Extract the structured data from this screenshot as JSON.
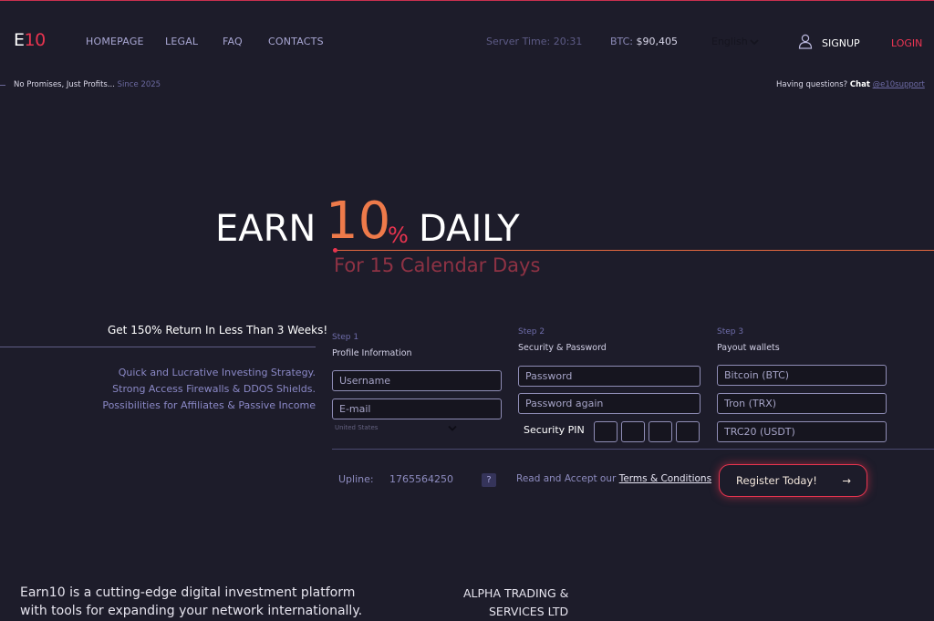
{
  "header": {
    "logo_e": "E",
    "logo_num": "10",
    "nav": [
      {
        "label": "HOMEPAGE"
      },
      {
        "label": "LEGAL"
      },
      {
        "label": "FAQ"
      },
      {
        "label": "CONTACTS"
      }
    ],
    "server_time_label": "Server Time:",
    "server_time": "20:31",
    "btc_label": "BTC:",
    "btc_price": "$90,405",
    "language": "English",
    "signup_label": "SIGNUP",
    "login_label": "LOGIN"
  },
  "subheader": {
    "tagline": "No Promises, Just Profits...",
    "since": "Since 2025",
    "questions": "Having questions?",
    "chat": "Chat",
    "support_handle": "@e10support"
  },
  "hero": {
    "earn": "EARN",
    "number": "10",
    "percent": "%",
    "daily": "DAILY",
    "subline": "For 15 Calendar Days"
  },
  "info": {
    "headline": "Get 150% Return In Less Than 3 Weeks!",
    "features": [
      "Quick and Lucrative Investing Strategy.",
      "Strong Access Firewalls & DDOS Shields.",
      "Possibilities for Affiliates & Passive Income"
    ]
  },
  "form": {
    "step1": {
      "step": "Step 1",
      "title": "Profile Information"
    },
    "step2": {
      "step": "Step 2",
      "title": "Security & Password"
    },
    "step3": {
      "step": "Step 3",
      "title": "Payout wallets"
    },
    "username_placeholder": "Username",
    "email_placeholder": "E-mail",
    "country": "United States",
    "password_placeholder": "Password",
    "password_again_placeholder": "Password again",
    "pin_label": "Security PIN",
    "btc_wallet_placeholder": "Bitcoin (BTC)",
    "trx_wallet_placeholder": "Tron (TRX)",
    "usdt_wallet_placeholder": "TRC20 (USDT)",
    "upline_label": "Upline:",
    "upline_value": "1765564250",
    "help": "?",
    "terms_text": "Read and Accept our",
    "terms_link": "Terms & Conditions",
    "register_label": "Register Today!",
    "register_arrow": "→"
  },
  "footer": {
    "desc_line1": "Earn10 is a cutting-edge digital investment platform",
    "desc_line2": "with tools for expanding your network internationally.",
    "company_line1": "ALPHA TRADING &",
    "company_line2": "SERVICES LTD"
  },
  "colors": {
    "background": "#1d1c2a",
    "accent_red": "#e8344f",
    "accent_orange": "#ee7a4a",
    "muted_purple": "#8a88c6"
  }
}
